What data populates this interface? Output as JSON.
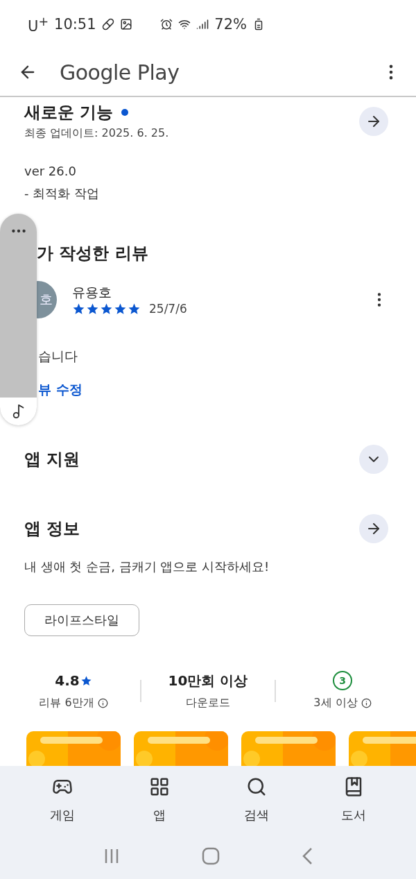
{
  "status_bar": {
    "carrier": "U$^{+}$",
    "time": "10:51",
    "battery": "72%"
  },
  "app_bar": {
    "title": "Google Play"
  },
  "whats_new": {
    "title": "새로운 기능",
    "new_dot": true,
    "updated": "최종 업데이트: 2025. 6. 25.",
    "notes": [
      "ver 26.0",
      "- 최적화 작업"
    ]
  },
  "my_review": {
    "title": "가 작성한 리뷰",
    "avatar": "호",
    "name": "유용호",
    "stars": 5,
    "date": "25/7/6",
    "text": "습니다",
    "edit_link": "뷰 수정"
  },
  "sections": [
    {
      "title": "앱 지원",
      "kind": "expand"
    },
    {
      "title": "앱 정보",
      "kind": "arrow"
    }
  ],
  "description": "내 생애 첫 순금, 금캐기 앱으로 시작하세요!",
  "category_chip": "라이프스타일",
  "stats": [
    {
      "kind": "rating",
      "value": "4.8",
      "label": "리뷰 6만개",
      "info": true
    },
    {
      "kind": "text",
      "value": "10만회 이상",
      "label": "다운로드",
      "info": false
    },
    {
      "kind": "age",
      "value": "3",
      "label": "3세 이상",
      "info": true
    }
  ],
  "bottom_nav": [
    {
      "label": "게임",
      "kind": "games"
    },
    {
      "label": "앱",
      "kind": "apps"
    },
    {
      "label": "검색",
      "kind": "search"
    },
    {
      "label": "도서",
      "kind": "books"
    }
  ]
}
